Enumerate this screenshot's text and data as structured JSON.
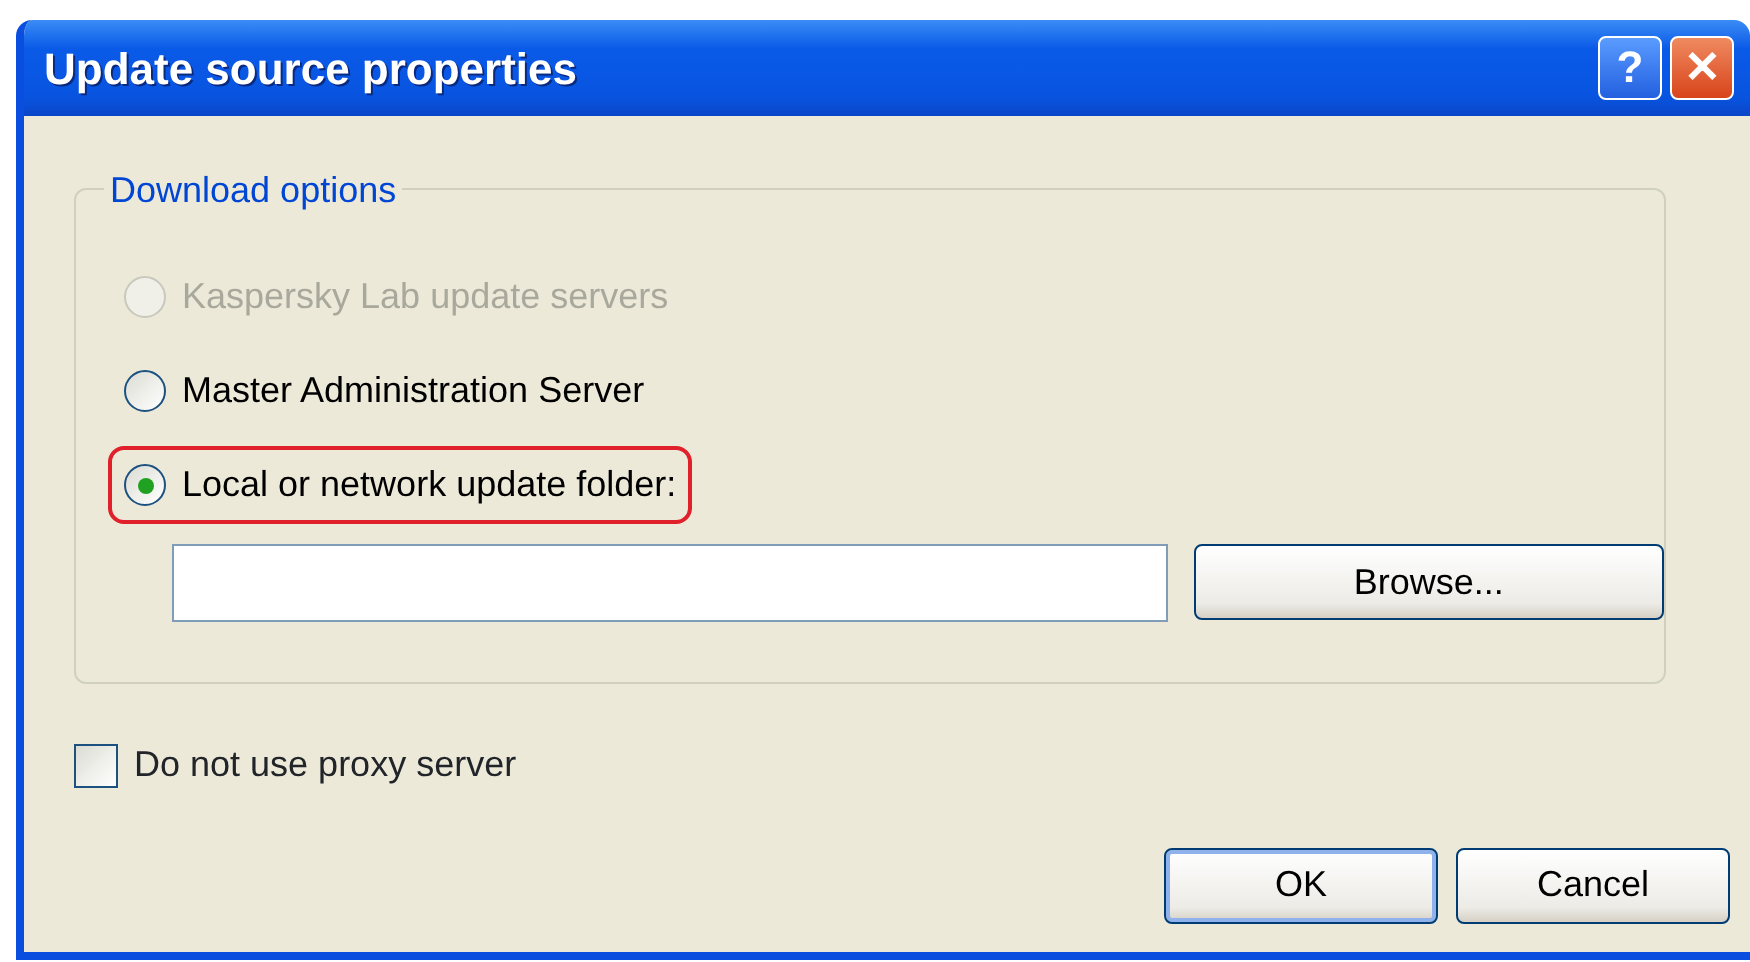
{
  "window": {
    "title": "Update source properties",
    "buttons": [
      {
        "kind": "help",
        "label": "?"
      },
      {
        "kind": "close",
        "label": "✕"
      }
    ]
  },
  "download_options": {
    "title": "Download options",
    "options": [
      {
        "label": "Kaspersky Lab update servers",
        "selected": false,
        "disabled": true,
        "highlighted": false
      },
      {
        "label": "Master Administration Server",
        "selected": false,
        "disabled": false,
        "highlighted": false
      },
      {
        "label": "Local or network update folder:",
        "selected": true,
        "disabled": false,
        "highlighted": true
      }
    ],
    "browse_button": "Browse..."
  },
  "proxy_checkbox": {
    "label": "Do not use proxy server",
    "checked": false
  },
  "buttons": [
    {
      "label": "OK",
      "default": true
    },
    {
      "label": "Cancel",
      "default": false
    }
  ]
}
